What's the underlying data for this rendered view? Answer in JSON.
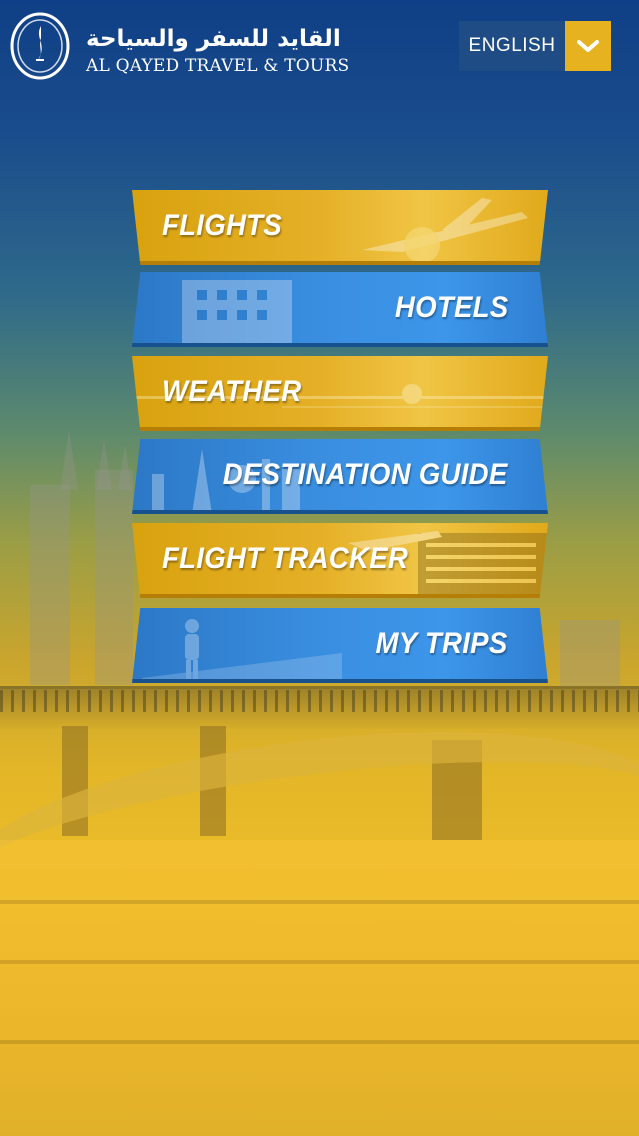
{
  "header": {
    "logo_arabic": "القايد للسفر والسياحة",
    "logo_english": "AL QAYED TRAVEL & TOURS",
    "language": {
      "selected": "ENGLISH",
      "icon": "chevron-down-icon"
    }
  },
  "menu": {
    "flights": "FLIGHTS",
    "hotels": "HOTELS",
    "weather": "WEATHER",
    "destination_guide": "DESTINATION GUIDE",
    "flight_tracker": "FLIGHT TRACKER",
    "my_trips": "MY TRIPS"
  },
  "colors": {
    "gold": "#e5b027",
    "blue": "#3a8ee0",
    "header_blue": "#204c86",
    "accent_gold": "#e7b21f"
  }
}
